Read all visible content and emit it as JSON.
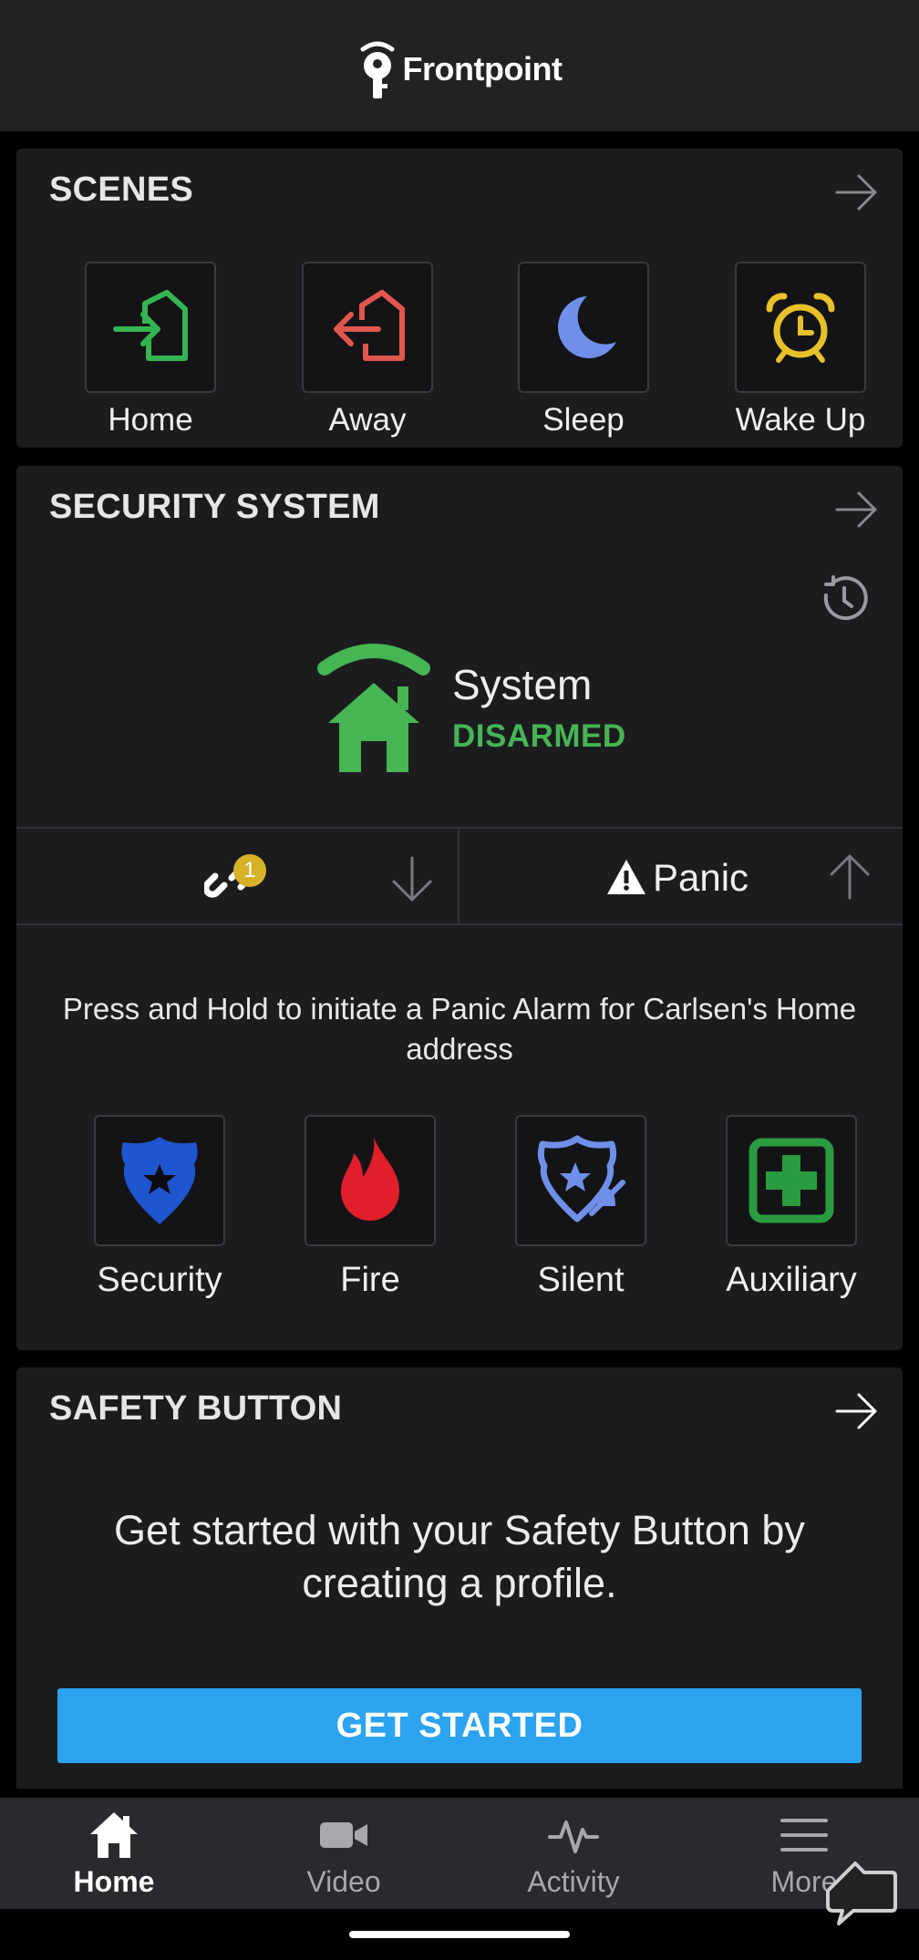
{
  "app": {
    "brand": "Frontpoint"
  },
  "scenes": {
    "title": "SCENES",
    "items": [
      {
        "label": "Home",
        "icon": "home-arrive-icon",
        "color": "#34b552"
      },
      {
        "label": "Away",
        "icon": "home-leave-icon",
        "color": "#e0574f"
      },
      {
        "label": "Sleep",
        "icon": "moon-icon",
        "color": "#6f8fe8"
      },
      {
        "label": "Wake Up",
        "icon": "alarm-clock-icon",
        "color": "#e8c12a"
      }
    ]
  },
  "security": {
    "title": "SECURITY SYSTEM",
    "status_label": "System",
    "status_value": "DISARMED",
    "status_color": "#46b553",
    "badge_count": "1",
    "panic_label": "Panic",
    "panic_description": "Press and Hold to initiate a Panic Alarm for Carlsen's Home address",
    "panic_items": [
      {
        "label": "Security",
        "icon": "police-badge-icon",
        "color": "#1f55cf"
      },
      {
        "label": "Fire",
        "icon": "flame-icon",
        "color": "#e11f2b"
      },
      {
        "label": "Silent",
        "icon": "silent-badge-icon",
        "color": "#6f8fe8"
      },
      {
        "label": "Auxiliary",
        "icon": "medical-cross-icon",
        "color": "#2b9b3f"
      }
    ]
  },
  "safety": {
    "title": "SAFETY BUTTON",
    "message": "Get started with your Safety Button by creating a profile.",
    "button_label": "GET STARTED",
    "button_color": "#2ba3ef"
  },
  "nav": {
    "items": [
      {
        "label": "Home",
        "icon": "home-icon",
        "active": true
      },
      {
        "label": "Video",
        "icon": "video-camera-icon",
        "active": false
      },
      {
        "label": "Activity",
        "icon": "activity-pulse-icon",
        "active": false
      },
      {
        "label": "More",
        "icon": "hamburger-menu-icon",
        "active": false
      }
    ]
  }
}
